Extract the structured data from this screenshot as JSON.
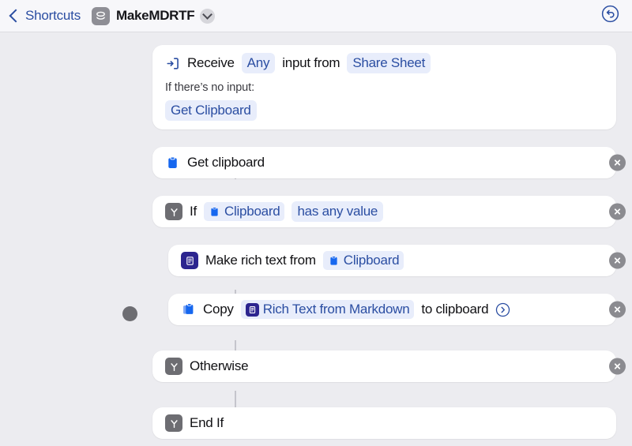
{
  "header": {
    "back_label": "Shortcuts",
    "back_icon": "chevron-left-icon",
    "app_icon": "shortcuts-app-icon",
    "title": "MakeMDRTF",
    "title_chevron_icon": "chevron-down-icon",
    "undo_icon": "undo-circle-icon"
  },
  "colors": {
    "background": "#ececf0",
    "navbar": "#f7f7fa",
    "card": "#ffffff",
    "accent_blue": "#2b4ea2",
    "token_bg": "#e8edfb",
    "icon_gray": "#6d6d72",
    "icon_indigo": "#2c258f",
    "clipboard_blue": "#1667ef"
  },
  "flow": {
    "cards": [
      {
        "id": "receive-input",
        "icon": "import-input-icon",
        "segments": [
          {
            "type": "text",
            "value": "Receive"
          },
          {
            "type": "token",
            "value": "Any"
          },
          {
            "type": "text",
            "value": "input from"
          },
          {
            "type": "token",
            "value": "Share Sheet"
          }
        ],
        "sub_label": "If there’s no input:",
        "sub_token": "Get Clipboard",
        "has_delete": false,
        "indent": false
      },
      {
        "id": "get-clipboard",
        "icon": "clipboard-icon",
        "segments": [
          {
            "type": "text",
            "value": "Get clipboard"
          }
        ],
        "has_delete": true,
        "indent": false
      },
      {
        "id": "if-condition",
        "icon": "branch-icon",
        "segments": [
          {
            "type": "text",
            "value": "If"
          },
          {
            "type": "token_clipboard",
            "value": "Clipboard"
          },
          {
            "type": "token",
            "value": "has any value"
          }
        ],
        "has_delete": true,
        "indent": false
      },
      {
        "id": "make-rich-text",
        "icon": "rich-text-icon",
        "segments": [
          {
            "type": "text",
            "value": "Make rich text from"
          },
          {
            "type": "token_clipboard",
            "value": "Clipboard"
          }
        ],
        "has_delete": true,
        "indent": true
      },
      {
        "id": "copy-to-clipboard",
        "icon": "copy-clipboard-icon",
        "segments": [
          {
            "type": "text",
            "value": "Copy"
          },
          {
            "type": "token_richtext",
            "value": "Rich Text from Markdown"
          },
          {
            "type": "text",
            "value": "to clipboard"
          },
          {
            "type": "disclosure",
            "value": "chevron-right-circle-icon"
          }
        ],
        "has_delete": true,
        "indent": true
      },
      {
        "id": "otherwise",
        "icon": "branch-icon",
        "segments": [
          {
            "type": "text",
            "value": "Otherwise"
          }
        ],
        "has_delete": true,
        "indent": false
      },
      {
        "id": "end-if",
        "icon": "branch-icon",
        "segments": [
          {
            "type": "text",
            "value": "End If"
          }
        ],
        "has_delete": false,
        "indent": false
      }
    ],
    "drag_handle": "drag-dot-indicator"
  },
  "labels": {
    "receive_1": "Receive",
    "receive_any": "Any",
    "receive_2": "input from",
    "receive_share": "Share Sheet",
    "no_input": "If there’s no input:",
    "get_clipboard_token": "Get Clipboard",
    "get_clipboard": "Get clipboard",
    "if": "If",
    "clipboard": "Clipboard",
    "has_any_value": "has any value",
    "make_rich_text": "Make rich text from",
    "copy": "Copy",
    "rich_text_from_markdown": "Rich Text from Markdown",
    "to_clipboard": "to clipboard",
    "otherwise": "Otherwise",
    "end_if": "End If"
  }
}
